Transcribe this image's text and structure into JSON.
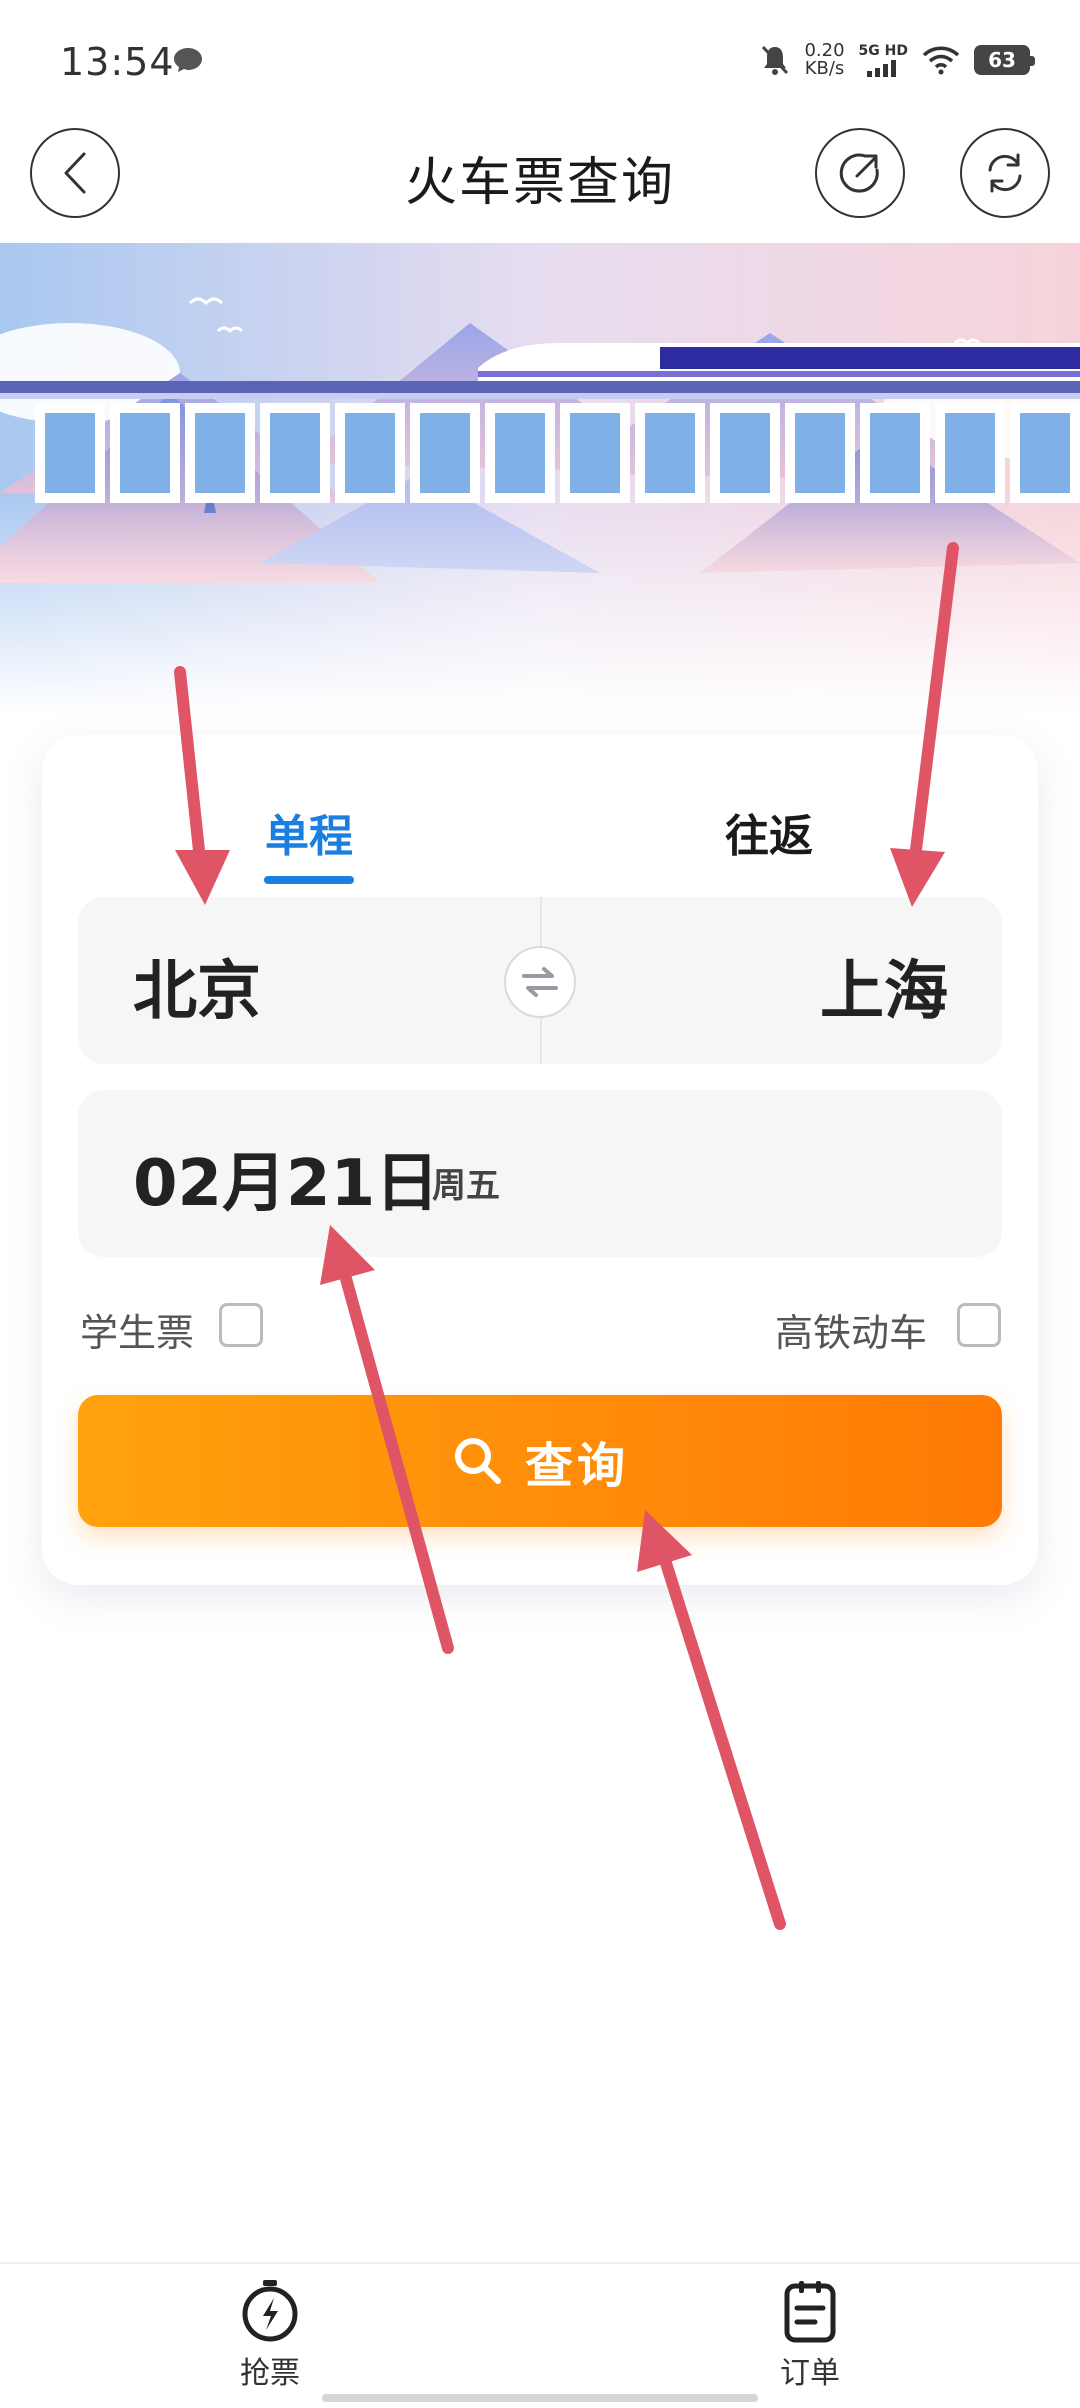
{
  "status_bar": {
    "time": "13:54",
    "net_speed_value": "0.20",
    "net_speed_unit": "KB/s",
    "net_type": "5G HD",
    "battery": "63"
  },
  "header": {
    "title": "火车票查询",
    "icons": [
      "back-icon",
      "share-icon",
      "refresh-icon"
    ]
  },
  "tabs": {
    "single": "单程",
    "round": "往返",
    "active": "single"
  },
  "route": {
    "from": "北京",
    "to": "上海"
  },
  "date": {
    "main": "02月21日",
    "weekday": "周五"
  },
  "options": {
    "student_label": "学生票",
    "student_checked": false,
    "hsr_label": "高铁动车",
    "hsr_checked": false
  },
  "search": {
    "label": "查询"
  },
  "bottom_nav": {
    "grab_label": "抢票",
    "order_label": "订单"
  },
  "colors": {
    "accent_blue": "#1a7fe0",
    "search_orange_start": "#ffa20d",
    "search_orange_end": "#ff7a05",
    "annotation_arrow": "#e05565"
  }
}
